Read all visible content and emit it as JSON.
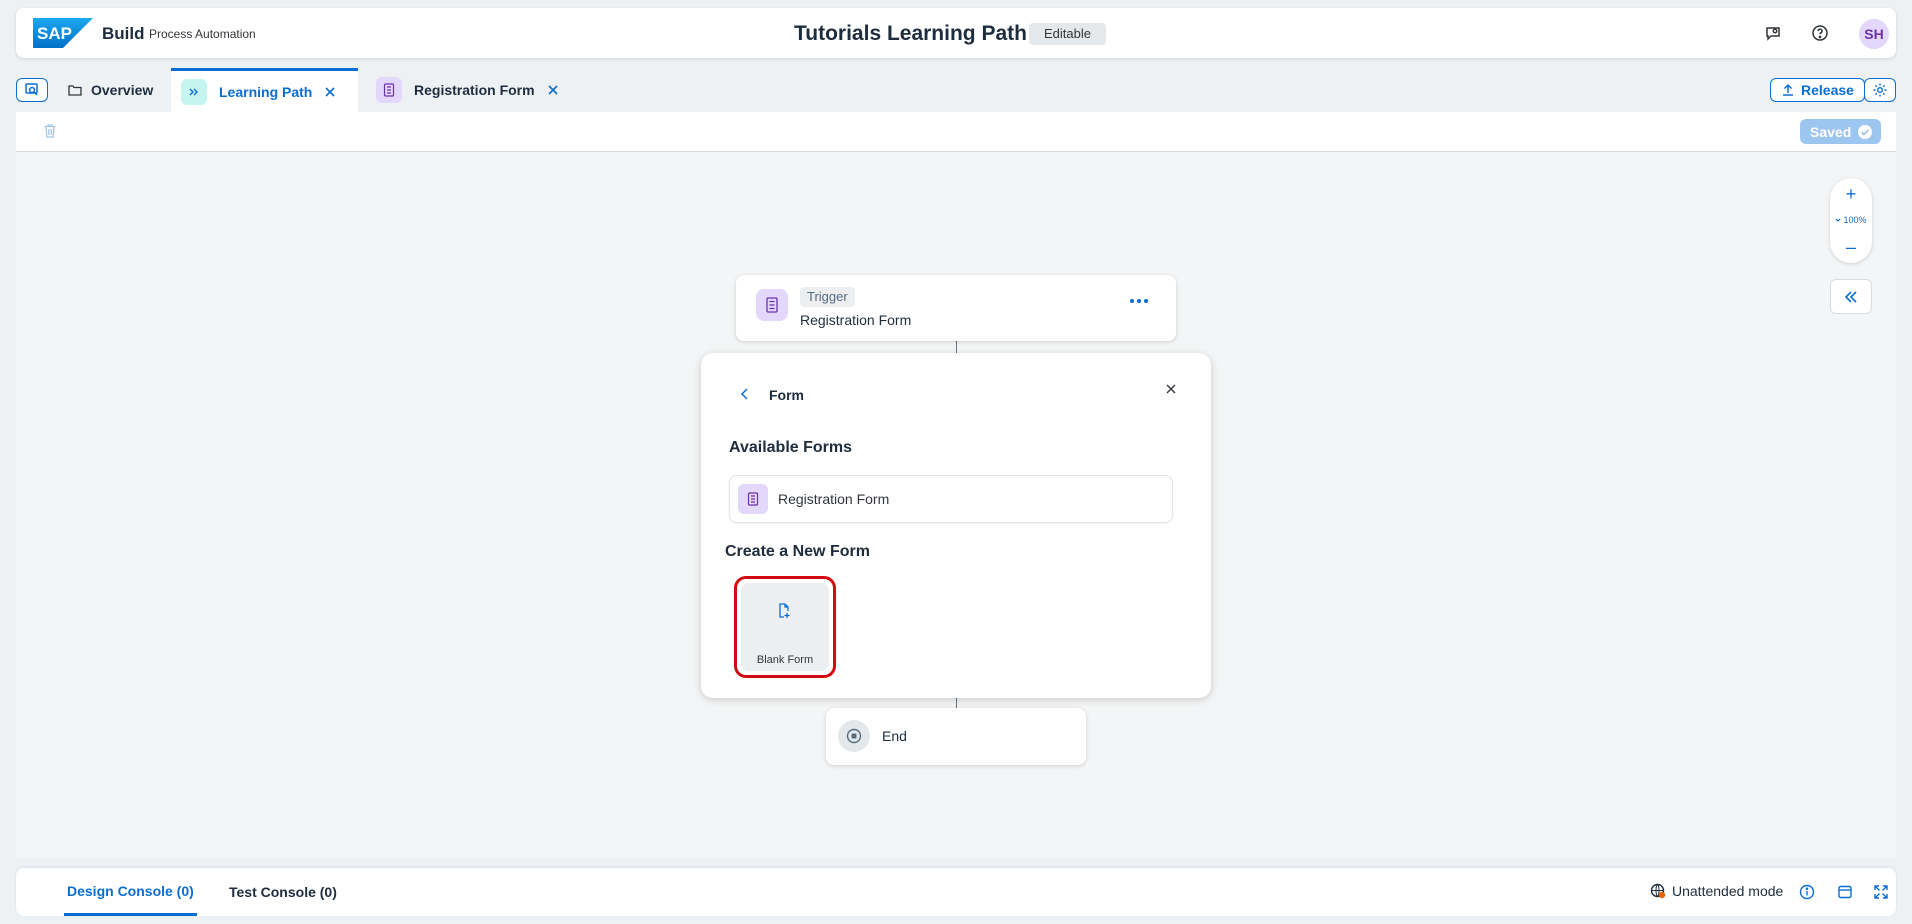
{
  "shell": {
    "brand": "Build",
    "product": "Process Automation",
    "title": "Tutorials Learning Path",
    "status": "Editable",
    "avatar": "SH"
  },
  "tabs": [
    {
      "label": "Overview"
    },
    {
      "label": "Learning Path"
    },
    {
      "label": "Registration Form"
    }
  ],
  "tabbar": {
    "release_label": "Release"
  },
  "toolbar": {
    "saved_label": "Saved"
  },
  "zoom": {
    "level": "100%"
  },
  "trigger": {
    "tag": "Trigger",
    "name": "Registration Form"
  },
  "popover": {
    "title": "Form",
    "available_title": "Available Forms",
    "available_forms": [
      {
        "label": "Registration Form"
      }
    ],
    "create_title": "Create a New Form",
    "blank_form_label": "Blank Form"
  },
  "end": {
    "label": "End"
  },
  "console": {
    "design_tab": "Design Console (0)",
    "test_tab": "Test Console (0)",
    "mode_label": "Unattended mode"
  },
  "colors": {
    "accent": "#0a6ed1",
    "highlight": "#d20a11",
    "purple_bg": "#e3d8fb",
    "teal_bg": "#c6f5ef"
  }
}
